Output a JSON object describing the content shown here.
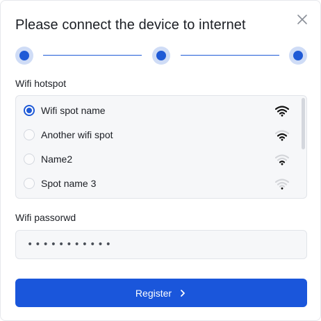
{
  "dialog": {
    "title": "Please connect the device to internet",
    "close_icon": "close-icon"
  },
  "stepper": {
    "steps": 3,
    "completed_steps": 3,
    "accent_color": "#1f5ad6"
  },
  "hotspot": {
    "label": "Wifi hotspot",
    "selected_index": 0,
    "items": [
      {
        "label": "Wifi spot name",
        "signal_level": 3
      },
      {
        "label": "Another wifi spot",
        "signal_level": 2
      },
      {
        "label": "Name2",
        "signal_level": 1
      },
      {
        "label": "Spot name 3",
        "signal_level": 0
      }
    ]
  },
  "password": {
    "label": "Wifi passorwd",
    "value": "•••••••••••"
  },
  "register": {
    "label": "Register",
    "icon": "chevron-right-icon",
    "color": "#1a56db"
  }
}
